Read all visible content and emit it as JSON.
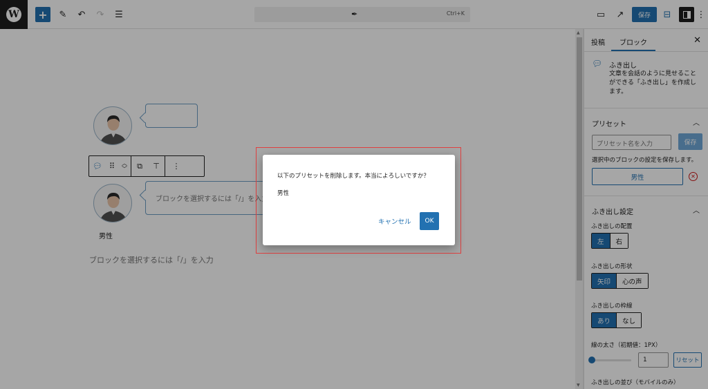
{
  "topbar": {
    "command_shortcut": "Ctrl+K",
    "save_label": "保存"
  },
  "canvas": {
    "block_placeholder": "ブロックを選択するには「/」を入力",
    "avatar_name": "男性",
    "paragraph_placeholder": "ブロックを選択するには「/」を入力"
  },
  "sidebar": {
    "tabs": [
      {
        "label": "投稿"
      },
      {
        "label": "ブロック"
      }
    ],
    "block": {
      "title": "ふき出し",
      "description": "文章を会話のように見せることができる「ふき出し」を作成します。"
    },
    "preset": {
      "heading": "プリセット",
      "name_placeholder": "プリセット名を入力",
      "save_label": "保存",
      "hint": "選択中のブロックの設定を保存します。",
      "item": "男性"
    },
    "bubble_settings": {
      "heading": "ふき出し設定",
      "placement_label": "ふき出しの配置",
      "placement_options": [
        "左",
        "右"
      ],
      "shape_label": "ふき出しの形状",
      "shape_options": [
        "矢印",
        "心の声"
      ],
      "border_label": "ふき出しの枠線",
      "border_options": [
        "あり",
        "なし"
      ],
      "thickness_label": "線の太さ（初期値：1PX）",
      "thickness_value": "1",
      "reset_label": "リセット",
      "mobile_label": "ふき出しの並び（モバイルのみ）"
    }
  },
  "dialog": {
    "message": "以下のプリセットを削除します。本当によろしいですか？",
    "preset_name": "男性",
    "cancel_label": "キャンセル",
    "ok_label": "OK"
  },
  "colors": {
    "accent": "#2271b1",
    "highlight": "#e04040",
    "danger": "#cc1818"
  }
}
